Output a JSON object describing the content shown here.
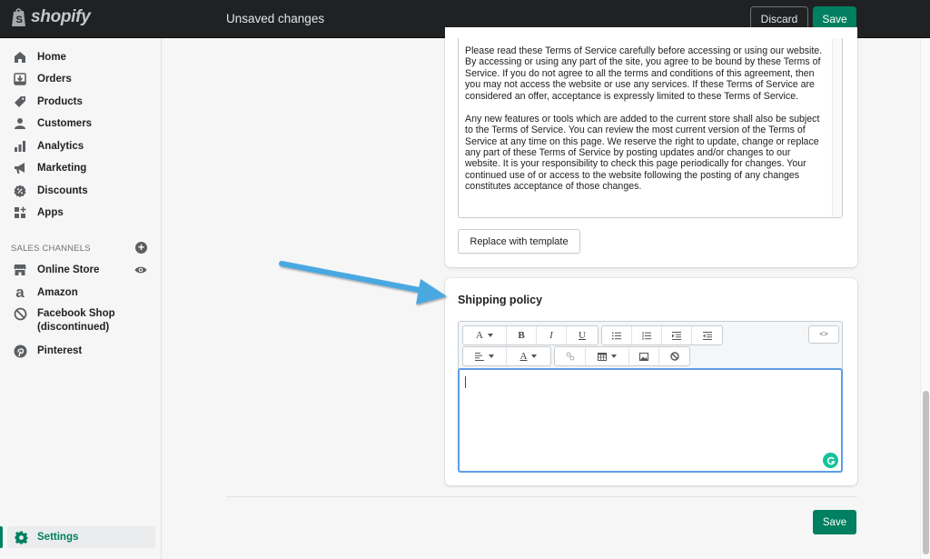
{
  "topbar": {
    "brand": "shopify",
    "status": "Unsaved changes",
    "discard_label": "Discard",
    "save_label": "Save"
  },
  "sidebar": {
    "items": [
      {
        "label": "Home",
        "icon": "home-icon"
      },
      {
        "label": "Orders",
        "icon": "orders-icon"
      },
      {
        "label": "Products",
        "icon": "tag-icon"
      },
      {
        "label": "Customers",
        "icon": "person-icon"
      },
      {
        "label": "Analytics",
        "icon": "bar-chart-icon"
      },
      {
        "label": "Marketing",
        "icon": "megaphone-icon"
      },
      {
        "label": "Discounts",
        "icon": "discount-icon"
      },
      {
        "label": "Apps",
        "icon": "apps-icon"
      }
    ],
    "sales_channels_title": "SALES CHANNELS",
    "channels": [
      {
        "label": "Online Store",
        "icon": "store-icon"
      },
      {
        "label": "Amazon",
        "icon": "amazon-icon"
      },
      {
        "label": "Facebook Shop",
        "label2": "(discontinued)",
        "icon": "blocked-icon"
      },
      {
        "label": "Pinterest",
        "icon": "pinterest-icon"
      }
    ],
    "settings_label": "Settings"
  },
  "terms_card": {
    "paragraphs": [
      "Please read these Terms of Service carefully before accessing or using our website. By accessing or using any part of the site, you agree to be bound by these Terms of Service. If you do not agree to all the terms and conditions of this agreement, then you may not access the website or use any services. If these Terms of Service are considered an offer, acceptance is expressly limited to these Terms of Service.",
      "Any new features or tools which are added to the current store shall also be subject to the Terms of Service. You can review the most current version of the Terms of Service at any time on this page. We reserve the right to update, change or replace any part of these Terms of Service by posting updates and/or changes to our website. It is your responsibility to check this page periodically for changes. Your continued use of or access to the website following the posting of any changes constitutes acceptance of those changes."
    ],
    "replace_label": "Replace with template"
  },
  "shipping_card": {
    "title": "Shipping policy",
    "toolbar": {
      "font": "A",
      "bold": "B",
      "italic": "I",
      "underline": "U",
      "text_color": "A",
      "code_view": "<>"
    },
    "content": ""
  },
  "footer": {
    "save_label": "Save"
  },
  "colors": {
    "accent": "#008060",
    "topbar": "#202123",
    "focus": "#5e9de6",
    "annotation_arrow": "#4aa8e0"
  }
}
